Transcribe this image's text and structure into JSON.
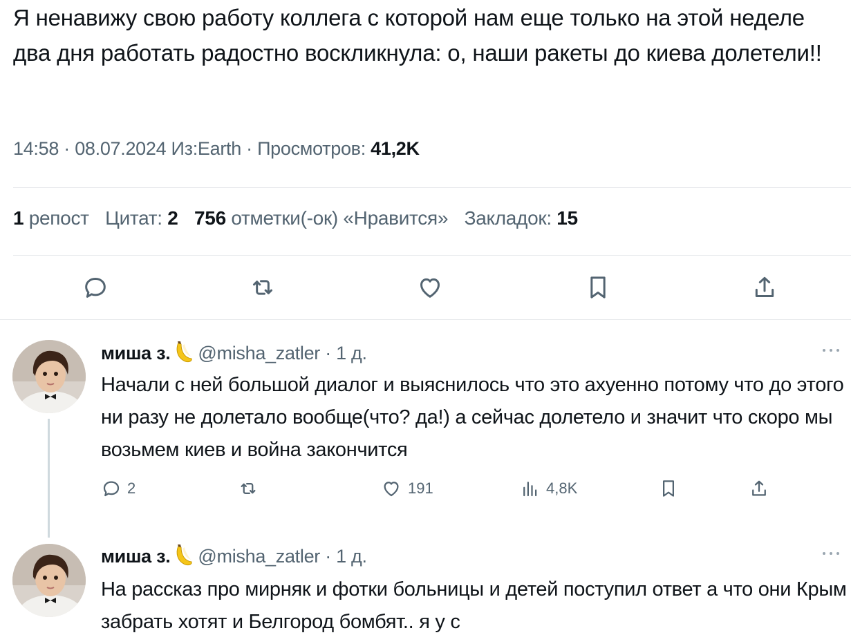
{
  "tweet": {
    "text": "Я ненавижу свою работу коллега с которой нам еще только на этой неделе два дня работать радостно воскликнула: о, наши ракеты до киева долетели!!",
    "time": "14:58",
    "date": "08.07.2024",
    "source": "Из:Earth",
    "views_label": "Просмотров:",
    "views_value": "41,2K",
    "dot": "·"
  },
  "stats": {
    "reposts_count": "1",
    "reposts_label": "репост",
    "quotes_label": "Цитат:",
    "quotes_count": "2",
    "likes_count": "756",
    "likes_label": "отметки(-ок) «Нравится»",
    "bookmarks_label": "Закладок:",
    "bookmarks_count": "15"
  },
  "icons": {
    "reply": "reply-icon",
    "repost": "repost-icon",
    "like": "heart-icon",
    "bookmark": "bookmark-icon",
    "share": "share-icon",
    "views": "bar-chart-icon",
    "more": "more-icon",
    "emoji": "banana-emoji"
  },
  "replies": [
    {
      "name": "миша з.",
      "handle": "@misha_zatler",
      "time": "· 1 д.",
      "text": "Начали с ней большой диалог и выяснилось что это ахуенно потому что до этого ни разу не долетало вообще(что? да!) а сейчас долетело и значит что скоро мы возьмем киев и война закончится",
      "reply_count": "2",
      "repost_count": "",
      "like_count": "191",
      "view_count": "4,8K"
    },
    {
      "name": "миша з.",
      "handle": "@misha_zatler",
      "time": "· 1 д.",
      "text": "На рассказ про мирняк и фотки больницы и детей поступил ответ а что они Крым забрать хотят и Белгород бомбят.. я у с"
    }
  ],
  "colors": {
    "text": "#0f1419",
    "secondary": "#536471",
    "divider": "#e7e9ec",
    "thread_line": "#cfd9de"
  }
}
